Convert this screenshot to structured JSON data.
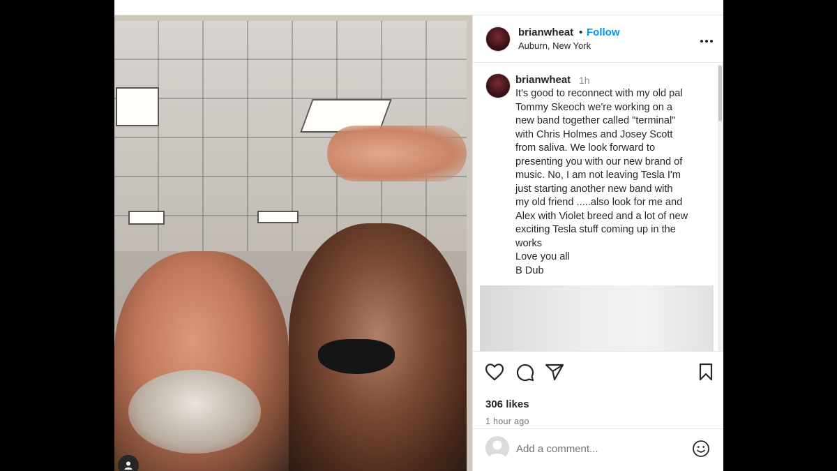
{
  "post": {
    "username": "brianwheat",
    "follow_separator": "•",
    "follow_label": "Follow",
    "location": "Auburn, New York",
    "more_label": "•••"
  },
  "caption": {
    "username": "brianwheat",
    "time": "1h",
    "lines": [
      "It's good to reconnect with my old pal",
      "Tommy Skeoch we're working on a",
      "new band together called \"terminal\"",
      "with Chris Holmes and Josey Scott",
      "from saliva. We look forward to",
      "presenting you with our new brand of",
      "music. No, I am not leaving Tesla I'm",
      "just starting another new band with",
      "my old friend .....also look for me and",
      "Alex with Violet breed and a lot of new",
      "exciting Tesla stuff coming up in the",
      "works",
      "Love you all",
      "B Dub"
    ]
  },
  "actions": {
    "likes": "306 likes",
    "time_ago": "1 hour ago"
  },
  "comment_box": {
    "placeholder": "Add a comment..."
  },
  "icons": {
    "like": "heart-icon",
    "comment": "comment-icon",
    "share": "send-icon",
    "save": "bookmark-icon",
    "emoji": "emoji-icon",
    "tagged_user": "user-icon",
    "more": "more-icon"
  },
  "colors": {
    "accent": "#0095f6",
    "text": "#262626",
    "muted": "#737373"
  }
}
